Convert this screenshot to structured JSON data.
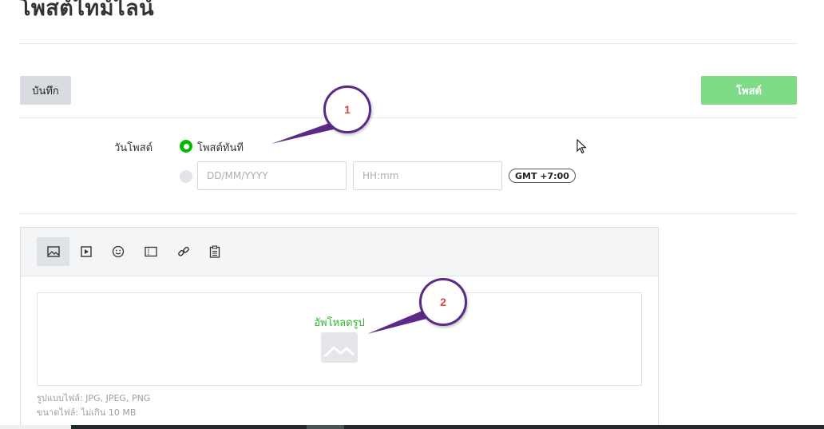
{
  "page": {
    "title": "โพสต์ไทม์ไลน์"
  },
  "actions": {
    "save_label": "บันทึก",
    "post_label": "โพสต์"
  },
  "schedule": {
    "label": "วันโพสต์",
    "post_now_label": "โพสต์ทันที",
    "post_now_selected": true,
    "date_placeholder": "DD/MM/YYYY",
    "time_placeholder": "HH:mm",
    "timezone": "GMT +7:00"
  },
  "editor": {
    "toolbar": [
      {
        "name": "image-icon",
        "active": true
      },
      {
        "name": "video-icon",
        "active": false
      },
      {
        "name": "sticker-icon",
        "active": false
      },
      {
        "name": "coupon-icon",
        "active": false
      },
      {
        "name": "link-icon",
        "active": false
      },
      {
        "name": "survey-icon",
        "active": false
      }
    ],
    "upload_label": "อัพโหลดรูป",
    "file_types_note": "รูปแบบไฟล์: JPG, JPEG, PNG",
    "file_size_note": "ขนาดไฟล์: ไม่เกิน 10 MB"
  },
  "callouts": {
    "one": "1",
    "two": "2"
  },
  "colors": {
    "accent_green": "#00b900",
    "post_button": "#7edb86",
    "callout_border": "#5b2a86",
    "callout_number": "#e0443c"
  }
}
